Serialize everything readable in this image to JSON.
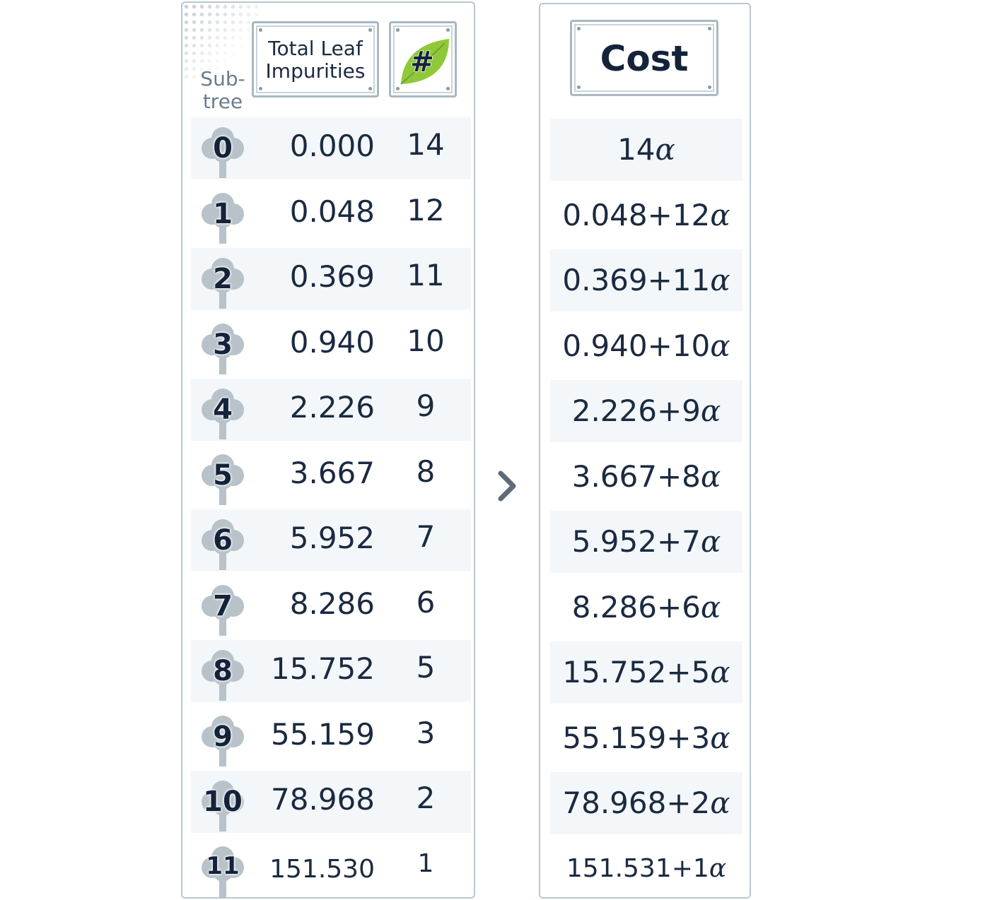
{
  "left_panel": {
    "subtree_label": "Sub-\ntree",
    "impurity_header": "Total Leaf Impurities",
    "count_header": "#",
    "rows": [
      {
        "id": "0",
        "impurity": "0.000",
        "count": "14"
      },
      {
        "id": "1",
        "impurity": "0.048",
        "count": "12"
      },
      {
        "id": "2",
        "impurity": "0.369",
        "count": "11"
      },
      {
        "id": "3",
        "impurity": "0.940",
        "count": "10"
      },
      {
        "id": "4",
        "impurity": "2.226",
        "count": "9"
      },
      {
        "id": "5",
        "impurity": "3.667",
        "count": "8"
      },
      {
        "id": "6",
        "impurity": "5.952",
        "count": "7"
      },
      {
        "id": "7",
        "impurity": "8.286",
        "count": "6"
      },
      {
        "id": "8",
        "impurity": "15.752",
        "count": "5"
      },
      {
        "id": "9",
        "impurity": "55.159",
        "count": "3"
      },
      {
        "id": "10",
        "impurity": "78.968",
        "count": "2"
      },
      {
        "id": "11",
        "impurity": "151.530",
        "count": "1"
      }
    ]
  },
  "right_panel": {
    "cost_header": "Cost",
    "rows": [
      {
        "prefix": "14",
        "alpha": "α"
      },
      {
        "prefix": "0.048+12",
        "alpha": "α"
      },
      {
        "prefix": "0.369+11",
        "alpha": "α"
      },
      {
        "prefix": "0.940+10",
        "alpha": "α"
      },
      {
        "prefix": "2.226+9",
        "alpha": "α"
      },
      {
        "prefix": "3.667+8",
        "alpha": "α"
      },
      {
        "prefix": "5.952+7",
        "alpha": "α"
      },
      {
        "prefix": "8.286+6",
        "alpha": "α"
      },
      {
        "prefix": "15.752+5",
        "alpha": "α"
      },
      {
        "prefix": "55.159+3",
        "alpha": "α"
      },
      {
        "prefix": "78.968+2",
        "alpha": "α"
      },
      {
        "prefix": "151.531+1",
        "alpha": "α"
      }
    ]
  },
  "colors": {
    "text": "#1b2a40",
    "tree_icon": "#b7c2c9",
    "leaf_green": "#8fc93a",
    "frame_border": "#a9b8c2",
    "row_shade": "#f3f7fa",
    "arrow": "#5f6b78"
  },
  "icons": {
    "tree": "tree-icon",
    "leaf": "leaf-icon",
    "arrow": "chevron-right-icon"
  }
}
